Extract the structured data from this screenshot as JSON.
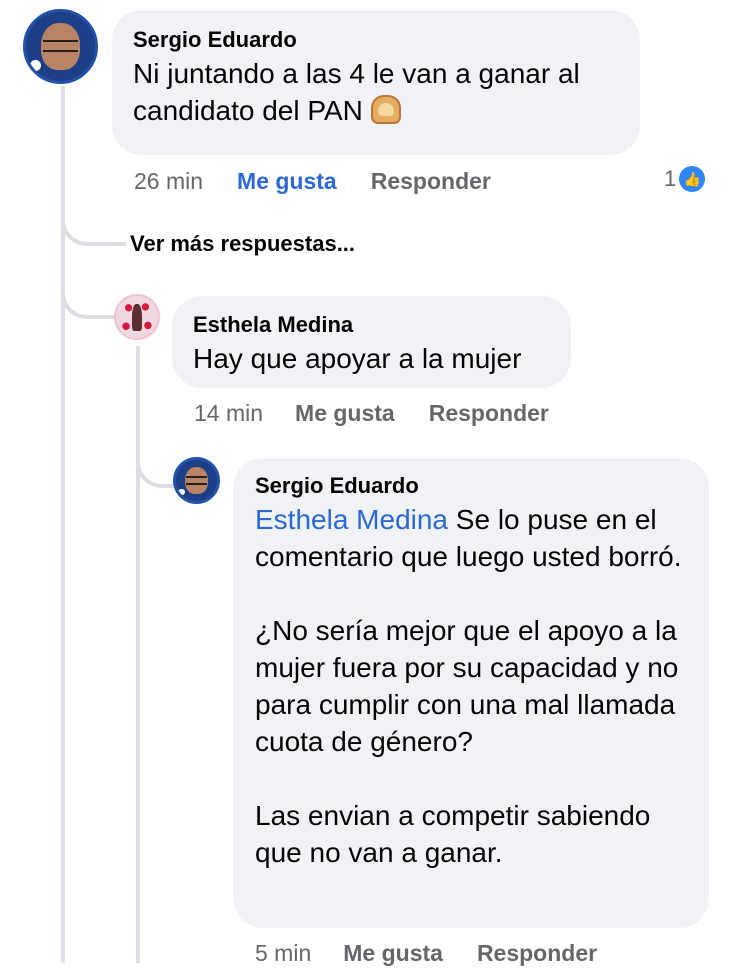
{
  "comments": [
    {
      "author": "Sergio Eduardo",
      "text": "Ni juntando a las 4 le van a ganar al candidato del PAN",
      "emoji_icon": "bread-icon",
      "time": "26 min",
      "like_label": "Me gusta",
      "reply_label": "Responder",
      "like_count": "1"
    },
    {
      "author": "Esthela Medina",
      "text": "Hay que apoyar a la mujer",
      "time": "14 min",
      "like_label": "Me gusta",
      "reply_label": "Responder"
    },
    {
      "author": "Sergio Eduardo",
      "mention": "Esthela Medina",
      "paragraph1": " Se lo puse en el comentario que luego usted borró.",
      "paragraph2": "¿No sería mejor que el apoyo a la mujer fuera por su capacidad y no para cumplir con una mal llamada cuota de género?",
      "paragraph3": "Las envian a competir sabiendo que no van a ganar.",
      "time": "5 min",
      "like_label": "Me gusta",
      "reply_label": "Responder"
    }
  ],
  "more_replies_label": "Ver más respuestas...",
  "colors": {
    "bubble": "#f0f2f5",
    "link_blue": "#2d69d5",
    "secondary_text": "#65676b",
    "thread_line": "#dcdee3",
    "like_badge": "#2d88ff"
  }
}
